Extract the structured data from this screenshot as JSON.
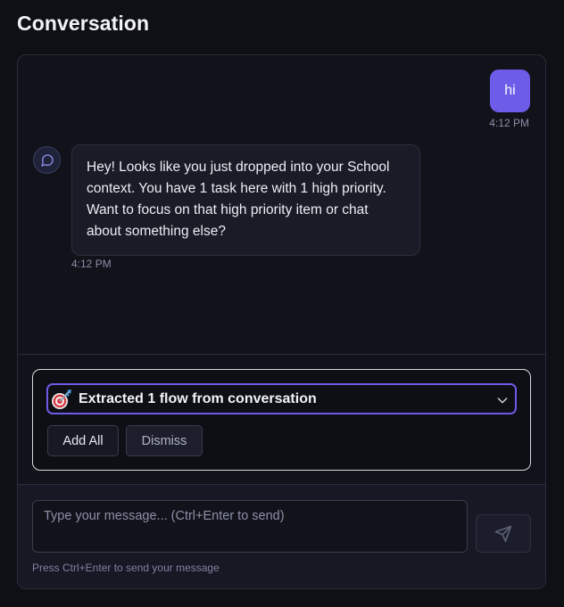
{
  "page": {
    "title": "Conversation"
  },
  "messages": {
    "user": {
      "text": "hi",
      "time": "4:12 PM"
    },
    "assistant": {
      "text": "Hey! Looks like you just dropped into your School context. You have 1 task here with 1 high priority. Want to focus on that high priority item or chat about something else?",
      "time": "4:12 PM"
    }
  },
  "flows": {
    "title": "Extracted 1 flow from conversation",
    "add_all_label": "Add All",
    "dismiss_label": "Dismiss"
  },
  "composer": {
    "placeholder": "Type your message... (Ctrl+Enter to send)",
    "value": "",
    "hint": "Press Ctrl+Enter to send your message"
  },
  "colors": {
    "accent": "#6c5ce7",
    "background": "#0f0f16",
    "panel": "#11121a"
  },
  "icons": {
    "assistant_avatar": "chat-bubble-icon",
    "flow": "target-icon",
    "expand": "chevron-down-icon",
    "send": "send-icon"
  }
}
